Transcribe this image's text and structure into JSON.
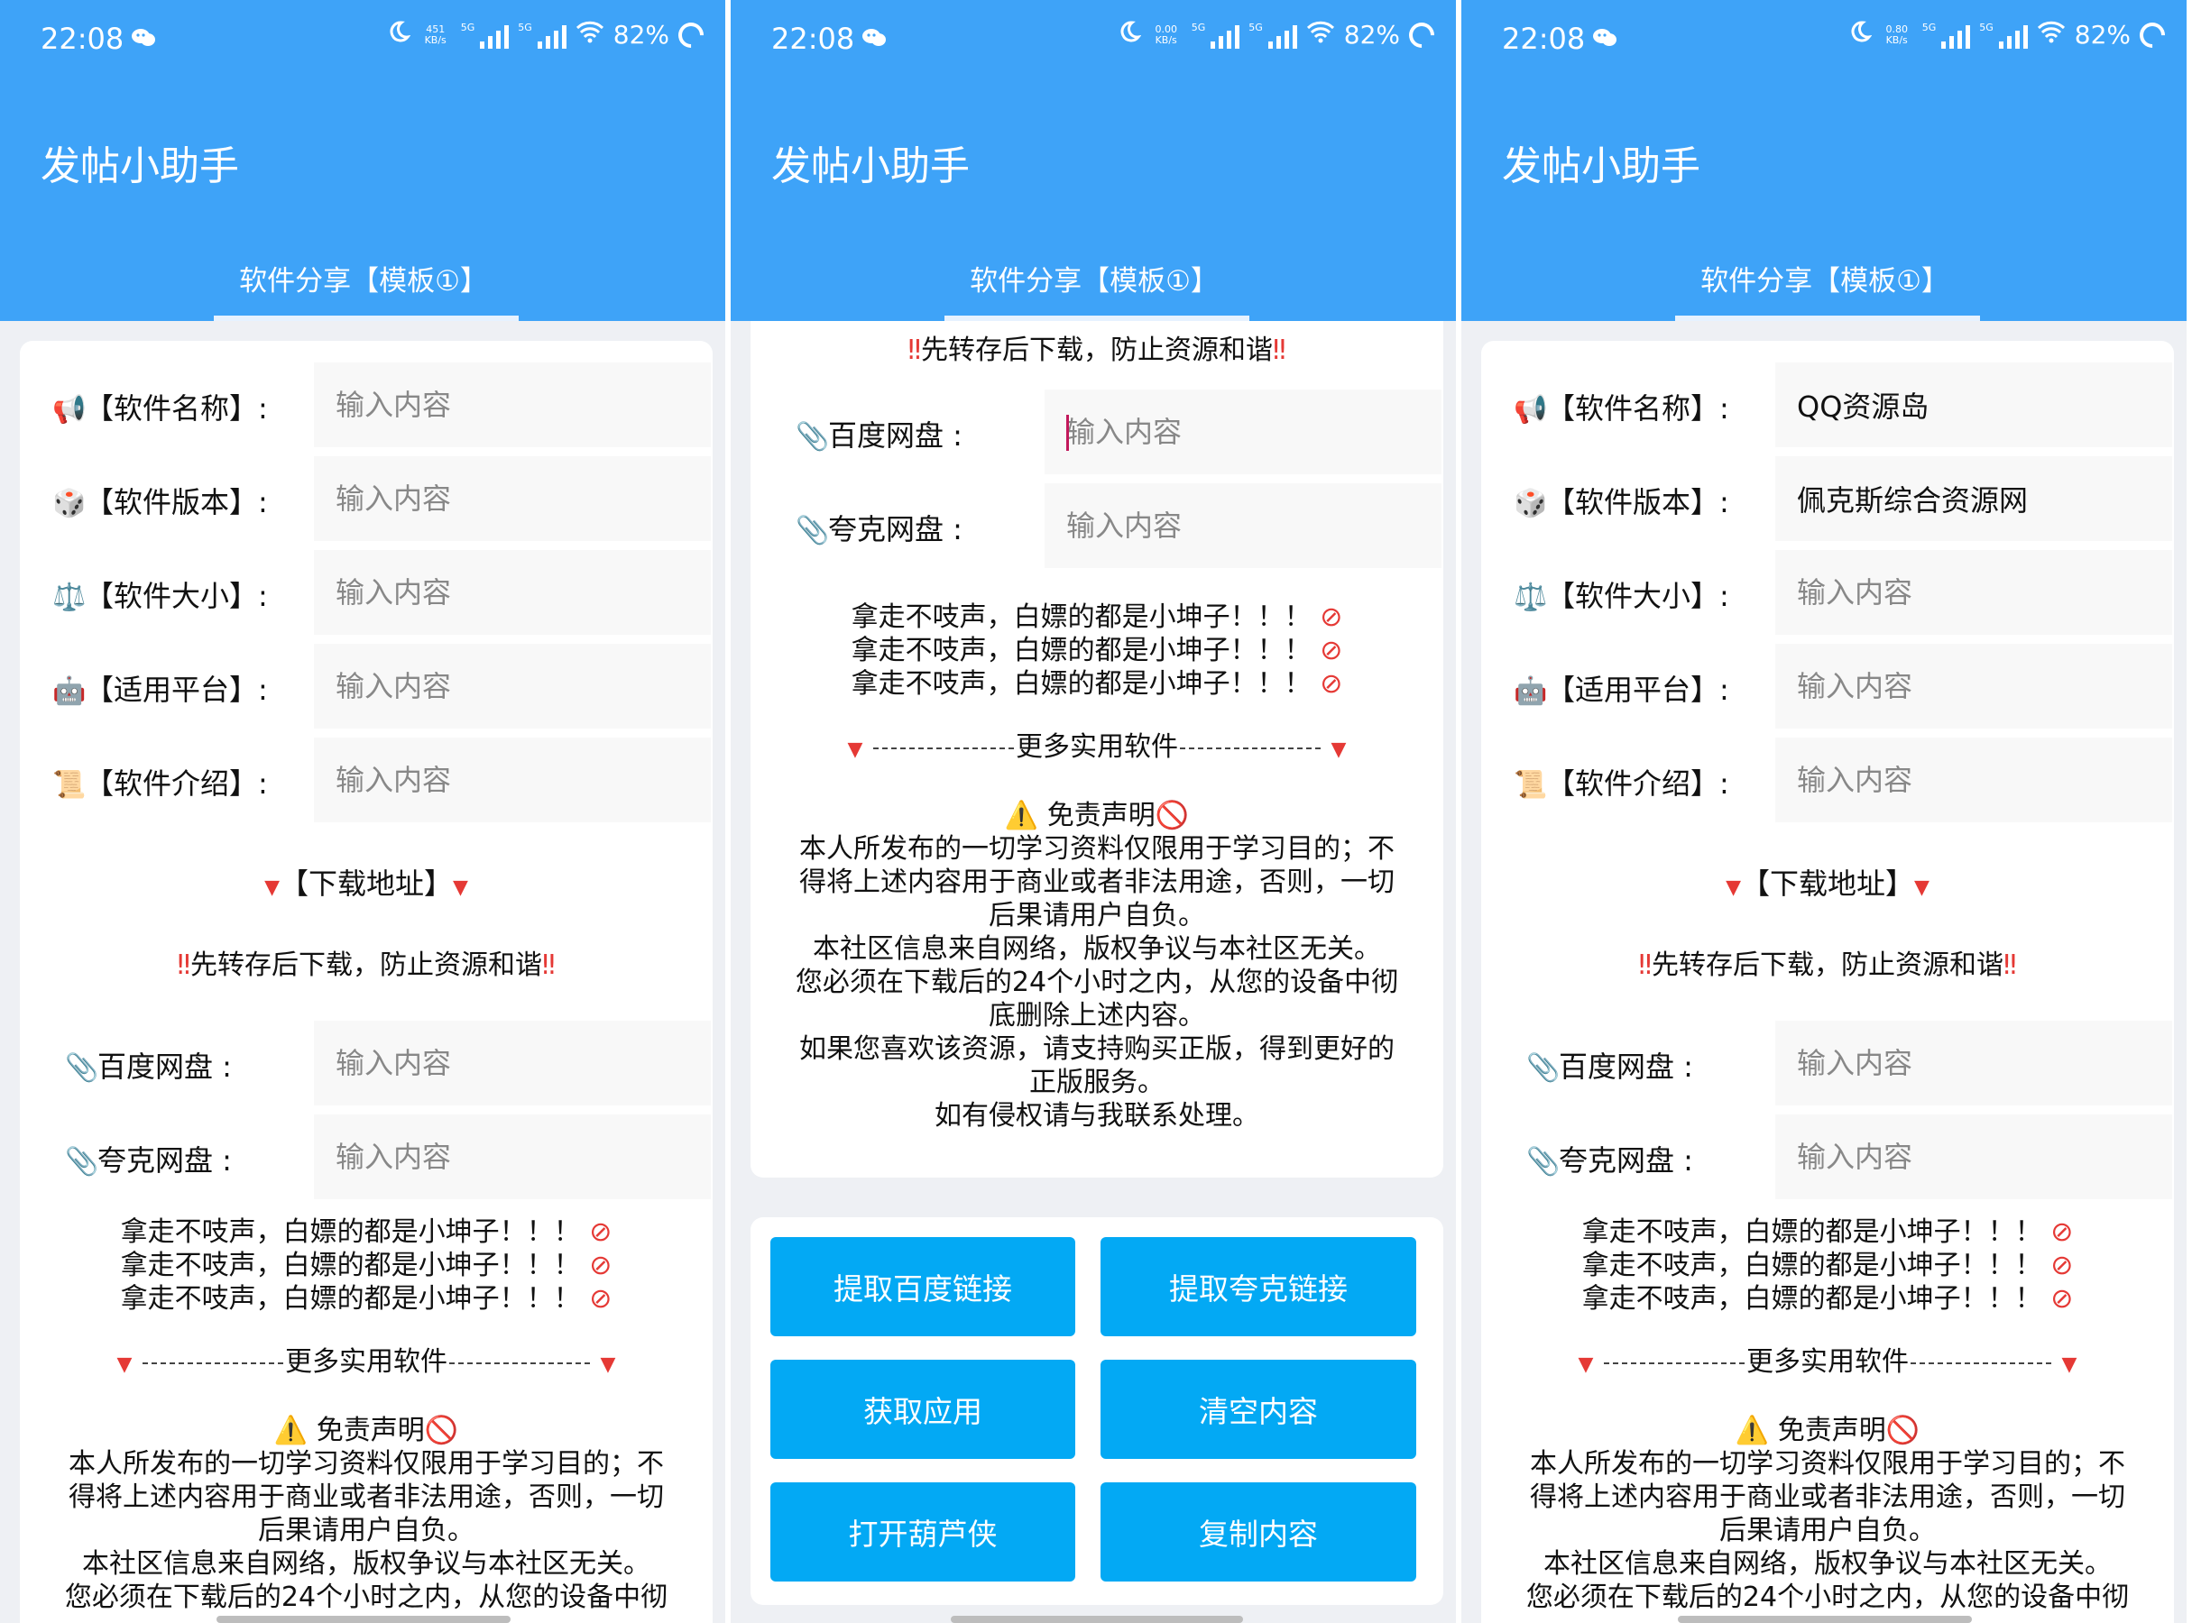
{
  "status": {
    "time": "22:08",
    "net_speed": [
      "451\nKB/s",
      "0.00\nKB/s",
      "0.80\nKB/s"
    ],
    "sim_label": "5G",
    "battery": "82%"
  },
  "app": {
    "title": "发帖小助手",
    "tab": "软件分享【模板①】",
    "accent": "#3ea3f8",
    "button_color": "#03a9f4"
  },
  "form": {
    "name_label": "【软件名称】:",
    "version_label": "【软件版本】:",
    "size_label": "【软件大小】:",
    "platform_label": "【适用平台】:",
    "intro_label": "【软件介绍】:",
    "placeholder": "输入内容",
    "download_heading": "【下载地址】",
    "warning": "先转存后下载，防止资源和谐",
    "baidu_label": "百度网盘 :",
    "quark_label": "夸克网盘 :",
    "filled_name": "QQ资源岛",
    "filled_version": "佩克斯综合资源网"
  },
  "notice": {
    "line": "拿走不吱声，白嫖的都是小坤子！！！",
    "more": "更多实用软件",
    "disclaimer_title": "免责声明",
    "d1": "本人所发布的一切学习资料仅限用于学习目的；不",
    "d2": "得将上述内容用于商业或者非法用途，否则，一切",
    "d3": "后果请用户自负。",
    "d4": "本社区信息来自网络，版权争议与本社区无关。",
    "d5": "您必须在下载后的24个小时之内，从您的设备中彻",
    "d6": "底删除上述内容。",
    "d7": "如果您喜欢该资源，请支持购买正版，得到更好的",
    "d8": "正版服务。",
    "d9": "如有侵权请与我联系处理。"
  },
  "buttons": {
    "baidu": "提取百度链接",
    "quark": "提取夸克链接",
    "get_app": "获取应用",
    "clear": "清空内容",
    "open_hlx": "打开葫芦侠",
    "copy": "复制内容"
  },
  "icons": {
    "name": "megaphone-icon",
    "version": "dice-icon",
    "size": "scales-icon",
    "platform": "robot-icon",
    "intro": "scroll-icon",
    "link": "paperclip-icon",
    "warning": "warning-icon",
    "no_entry": "prohibited-icon"
  }
}
